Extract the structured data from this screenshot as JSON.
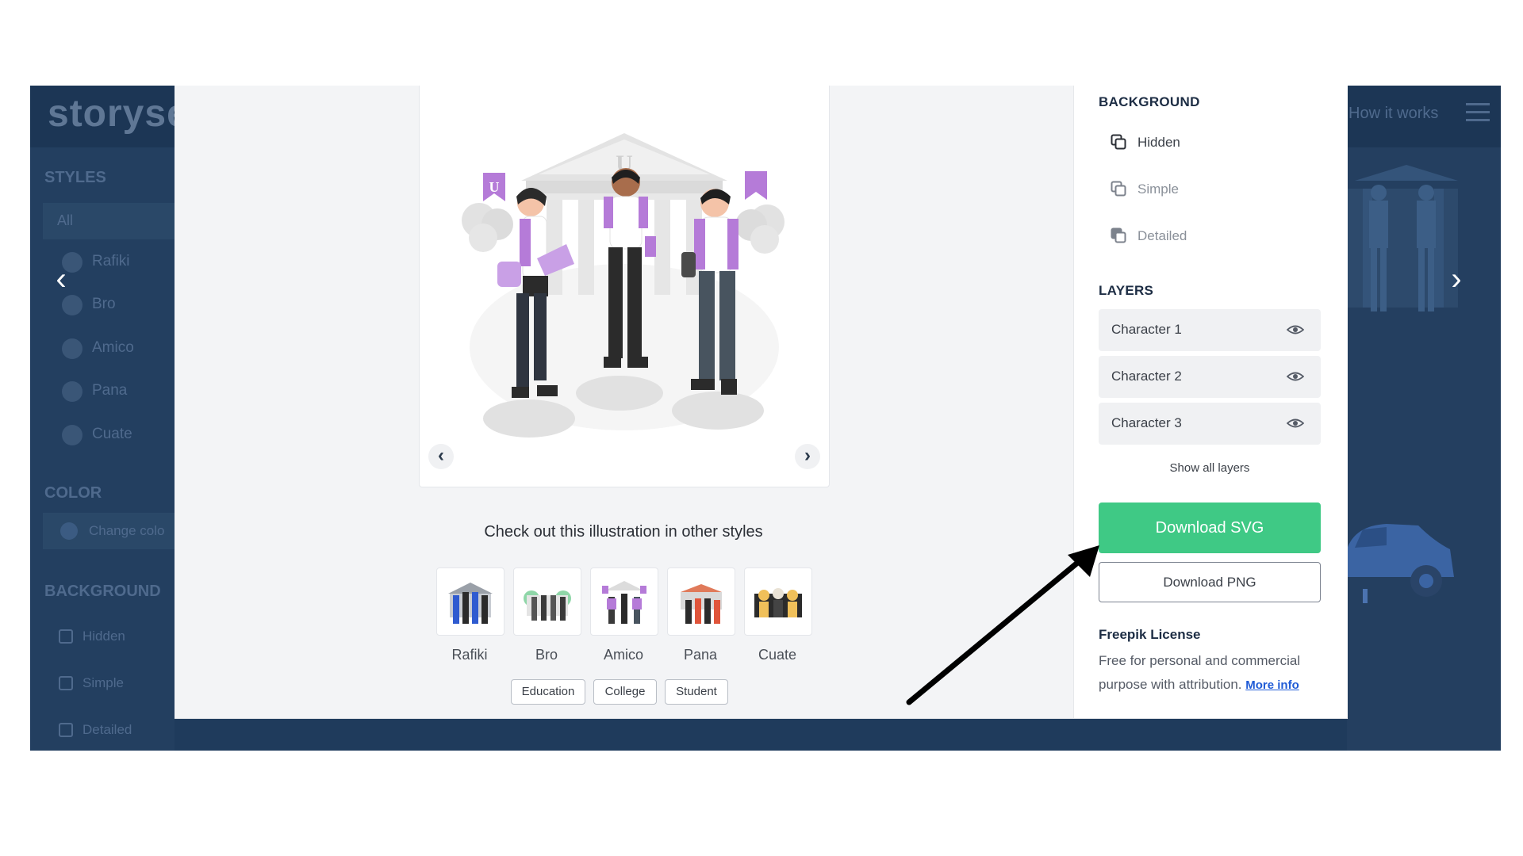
{
  "background_site": {
    "logo_text": "storyse",
    "styles_heading": "STYLES",
    "all_label": "All",
    "styles": [
      "Rafiki",
      "Bro",
      "Amico",
      "Pana",
      "Cuate"
    ],
    "color_heading": "COLOR",
    "color_button": "Change colo",
    "background_heading": "BACKGROUND",
    "background_options": [
      "Hidden",
      "Simple",
      "Detailed"
    ],
    "nav_link": "How it works"
  },
  "other_styles": {
    "title": "Check out this illustration in other styles",
    "items": [
      "Rafiki",
      "Bro",
      "Amico",
      "Pana",
      "Cuate"
    ],
    "tags": [
      "Education",
      "College",
      "Student"
    ]
  },
  "sidebar": {
    "background_heading": "BACKGROUND",
    "background_options": [
      {
        "label": "Hidden",
        "color": "#3b4048"
      },
      {
        "label": "Simple",
        "color": "#8a9099"
      },
      {
        "label": "Detailed",
        "color": "#8a9099"
      }
    ],
    "layers_heading": "LAYERS",
    "layers": [
      "Character 1",
      "Character 2",
      "Character 3"
    ],
    "show_all_layers": "Show all layers",
    "download_svg": "Download SVG",
    "download_png": "Download PNG",
    "license_title": "Freepik License",
    "license_text": "Free for personal and commercial purpose with attribution.",
    "license_link": "More info"
  },
  "colors": {
    "accent_green": "#3fc985",
    "overlay_navy": "#1f3b5c",
    "illustration_purple": "#b57bd8",
    "link_blue": "#1f5bd6"
  }
}
